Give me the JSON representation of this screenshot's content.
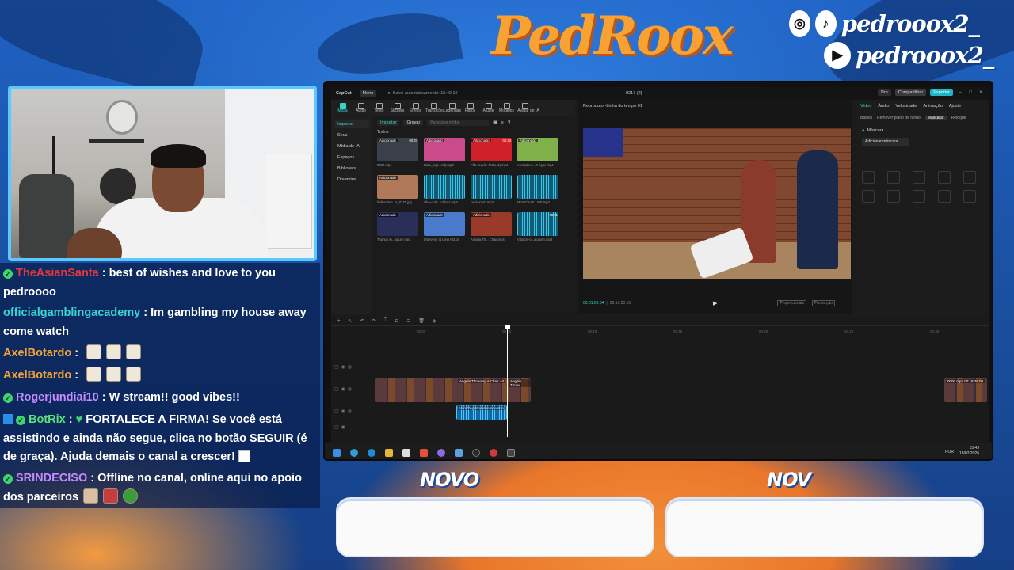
{
  "overlay": {
    "brand": "PedRoox",
    "social": [
      {
        "icon": "instagram-icon",
        "glyph": "◎",
        "handle": ""
      },
      {
        "icon": "tiktok-icon",
        "glyph": "♪",
        "handle": "pedrooox2_"
      },
      {
        "icon": "youtube-icon",
        "glyph": "▶",
        "handle": "pedrooox2_"
      }
    ],
    "novo_left": "NOVO",
    "novo_right": "NOV"
  },
  "chat": {
    "messages": [
      {
        "user": "TheAsianSanta",
        "color": "#e0383f",
        "sep": " : ",
        "text": "best of wishes and love to you pedroooo"
      },
      {
        "user": "officialgamblingacademy",
        "color": "#3cd3d4",
        "sep": " : ",
        "text": "Im gambling my house away come watch"
      },
      {
        "user": "AxelBotardo",
        "color": "#f2a33a",
        "sep": " : ",
        "text": ""
      },
      {
        "user": "AxelBotardo",
        "color": "#f2a33a",
        "sep": " : ",
        "text": ""
      },
      {
        "user": "Rogerjundiai10",
        "color": "#c58bff",
        "sep": " : ",
        "text": "W stream!! good vibes!!"
      },
      {
        "user": "BotRix",
        "color": "#5ae07a",
        "sep": " : ",
        "text": "FORTALECE A FIRMA! Se você está assistindo e ainda não segue, clica no botão SEGUIR (é de graça). Ajuda demais o canal a crescer!"
      },
      {
        "user": "SRINDECISO",
        "color": "#c58bff",
        "sep": " : ",
        "text": "Offline no canal, online aqui no apoio dos parceiros"
      }
    ]
  },
  "capcut": {
    "app_name": "CapCut",
    "menu_label": "Menu",
    "autosave": "Salvo automaticamente: 15:49:19",
    "project_name": "0217 (2)",
    "pro_label": "Pro",
    "share_label": "Compartilhar",
    "export_label": "Exportar",
    "tools": [
      "Mídia",
      "Áudio",
      "Texto",
      "Stickers",
      "Efeitos",
      "Transições",
      "Legendas",
      "Filtros",
      "Ajuste",
      "Modelos",
      "Avatar de IA"
    ],
    "nav": [
      "Importar",
      "Seus",
      "Mídia de IA",
      "Espaços",
      "Biblioteca",
      "Dreamina"
    ],
    "import_label": "Importar",
    "record_label": "Gravar",
    "search_placeholder": "Pesquisar mídia",
    "all_label": "Todos",
    "clips": [
      {
        "badge": "Adicionado",
        "dur": "00:37",
        "name": "0000.mp4",
        "color": "#3a3f4a"
      },
      {
        "badge": "Adicionado",
        "dur": "",
        "name": "Data_Sup...rat).mp4",
        "color": "#c94b8a"
      },
      {
        "badge": "Adicionado",
        "dur": "01:43",
        "name": "Pão Sujeit...FULL(1).mp4",
        "color": "#d0202a"
      },
      {
        "badge": "Adicionado",
        "dur": "",
        "name": "A visada d...O figue.mp4",
        "color": "#7fb04a"
      },
      {
        "badge": "Adicionado",
        "dur": "",
        "name": "hellen-ban...o_0170.jpg",
        "color": "#b07a5a"
      },
      {
        "badge": "",
        "dur": "",
        "name": "olhe-o-de...cábula.mp3",
        "color": "audio"
      },
      {
        "badge": "",
        "dur": "",
        "name": "ceal-boom.mp3",
        "color": "audio"
      },
      {
        "badge": "",
        "dur": "",
        "name": "MUSICA DI...IVE.mp3",
        "color": "audio"
      },
      {
        "badge": "Adicionado",
        "dur": "",
        "name": "Thanos wi...future.mp4",
        "color": "#2a2f5a"
      },
      {
        "badge": "Adicionado",
        "dur": "",
        "name": "Intervene (1).png (03.gif",
        "color": "#4a7acb"
      },
      {
        "badge": "Adicionado",
        "dur": "",
        "name": "Angela Th... Chair.mp4",
        "color": "#9a3a2a"
      },
      {
        "badge": "",
        "dur": "00:01",
        "name": "Vitorchi-o...alquotn.mp3",
        "color": "audio"
      }
    ],
    "player_title": "Reprodutor-Linha do tempo 01",
    "timecode": "00:01:09:04",
    "duration": "00:16:00:15",
    "ratio_label": "Proporcionais",
    "prop_label": "Proporção",
    "inspector_tabs": [
      "Vídeo",
      "Áudio",
      "Velocidade",
      "Animação",
      "Ajuste"
    ],
    "inspector_sub": [
      "Básico",
      "Remover plano de fundo",
      "Mascarar",
      "Retoque"
    ],
    "mask_label": "Máscara",
    "mask_add": "Adicionar máscara",
    "ruler": [
      "00:00",
      "00:05",
      "00:10",
      "00:15",
      "00:20",
      "00:25",
      "00:30"
    ],
    "clip_label": "Angela Throwing A Chair - 0",
    "clip_label2": "Angela Throw",
    "audio_label": "Vitorchi-pilon-bobo-no-vnt-o",
    "end_clip": "0000.mp4 00:16:36:00",
    "clock_time": "15:49",
    "clock_date": "18/02/2026",
    "lang": "POR"
  }
}
